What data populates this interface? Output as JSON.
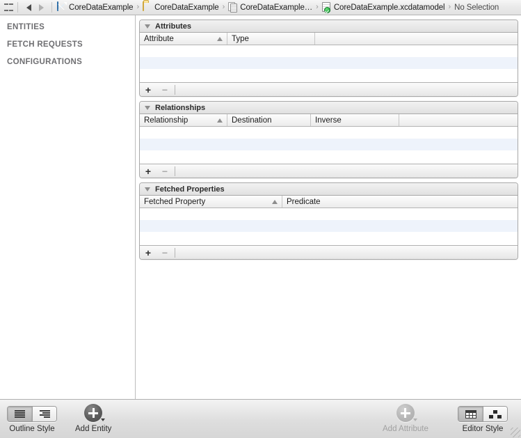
{
  "jumpbar": {
    "grid_icon": "grid-icon",
    "back_icon": "back-arrow-icon",
    "forward_icon": "forward-arrow-icon",
    "separator_chevron": "›",
    "crumbs": [
      {
        "label": "CoreDataExample",
        "icon": "xcode-project-icon"
      },
      {
        "label": "CoreDataExample",
        "icon": "folder-icon"
      },
      {
        "label": "CoreDataExample…",
        "icon": "documents-icon"
      },
      {
        "label": "CoreDataExample.xcdatamodel",
        "icon": "datamodel-icon"
      },
      {
        "label": "No Selection",
        "icon": "none"
      }
    ]
  },
  "sidebar": {
    "items": [
      {
        "label": "ENTITIES"
      },
      {
        "label": "FETCH REQUESTS"
      },
      {
        "label": "CONFIGURATIONS"
      }
    ]
  },
  "editor": {
    "sections": [
      {
        "title": "Attributes",
        "disclosure_icon": "disclosure-triangle-down-icon",
        "columns": [
          {
            "label": "Attribute",
            "sorted": true,
            "sort_icon": "sort-ascending-icon"
          },
          {
            "label": "Type",
            "sorted": false
          },
          {
            "label": "",
            "sorted": false
          }
        ],
        "rows": [],
        "row_count": 3,
        "add_label": "+",
        "remove_label": "−",
        "add_enabled": true,
        "remove_enabled": false
      },
      {
        "title": "Relationships",
        "disclosure_icon": "disclosure-triangle-down-icon",
        "columns": [
          {
            "label": "Relationship",
            "sorted": true,
            "sort_icon": "sort-ascending-icon"
          },
          {
            "label": "Destination",
            "sorted": false
          },
          {
            "label": "Inverse",
            "sorted": false
          },
          {
            "label": "",
            "sorted": false
          }
        ],
        "rows": [],
        "row_count": 3,
        "add_label": "+",
        "remove_label": "−",
        "add_enabled": true,
        "remove_enabled": false
      },
      {
        "title": "Fetched Properties",
        "disclosure_icon": "disclosure-triangle-down-icon",
        "columns": [
          {
            "label": "Fetched Property",
            "sorted": true,
            "sort_icon": "sort-ascending-icon"
          },
          {
            "label": "Predicate",
            "sorted": false
          }
        ],
        "rows": [],
        "row_count": 3,
        "add_label": "+",
        "remove_label": "−",
        "add_enabled": true,
        "remove_enabled": false
      }
    ]
  },
  "bottombar": {
    "outline_style": {
      "label": "Outline Style",
      "segments": [
        {
          "icon": "flat-outline-icon",
          "selected": true
        },
        {
          "icon": "hierarchical-outline-icon",
          "selected": false
        }
      ]
    },
    "add_entity": {
      "label": "Add Entity",
      "icon": "plus-circle-icon",
      "menu_icon": "menu-caret-icon",
      "enabled": true
    },
    "add_attribute": {
      "label": "Add Attribute",
      "icon": "plus-circle-icon",
      "menu_icon": "menu-caret-icon",
      "enabled": false
    },
    "editor_style": {
      "label": "Editor Style",
      "segments": [
        {
          "icon": "table-editor-icon",
          "selected": true
        },
        {
          "icon": "graph-editor-icon",
          "selected": false
        }
      ]
    },
    "resize_grip_icon": "resize-grip-icon"
  },
  "colors": {
    "alt_row": "#eef3fb",
    "sidebar_label": "#6f6f72",
    "accent_green": "#2bb148"
  }
}
